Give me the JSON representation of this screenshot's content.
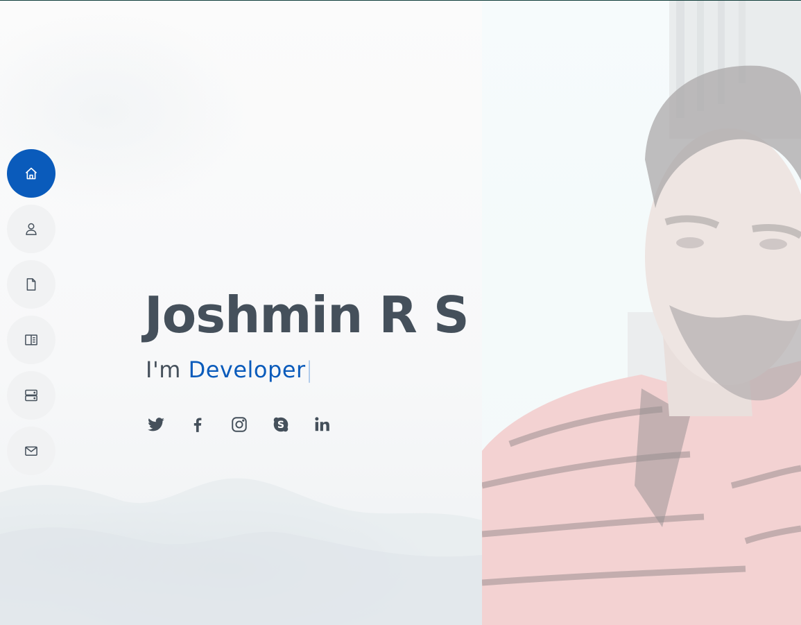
{
  "hero": {
    "name": "Joshmin R S",
    "prefix": "I'm",
    "typed": "Developer",
    "cursor": "|"
  },
  "nav": {
    "items": [
      {
        "icon": "home-icon",
        "active": true
      },
      {
        "icon": "person-icon",
        "active": false
      },
      {
        "icon": "file-icon",
        "active": false
      },
      {
        "icon": "book-half-icon",
        "active": false
      },
      {
        "icon": "server-icon",
        "active": false
      },
      {
        "icon": "envelope-icon",
        "active": false
      }
    ]
  },
  "social": [
    "twitter-icon",
    "facebook-icon",
    "instagram-icon",
    "skype-icon",
    "linkedin-icon"
  ],
  "colors": {
    "accent": "#0a5bbb",
    "text": "#45505b",
    "nav_bg": "#f1f2f3"
  }
}
